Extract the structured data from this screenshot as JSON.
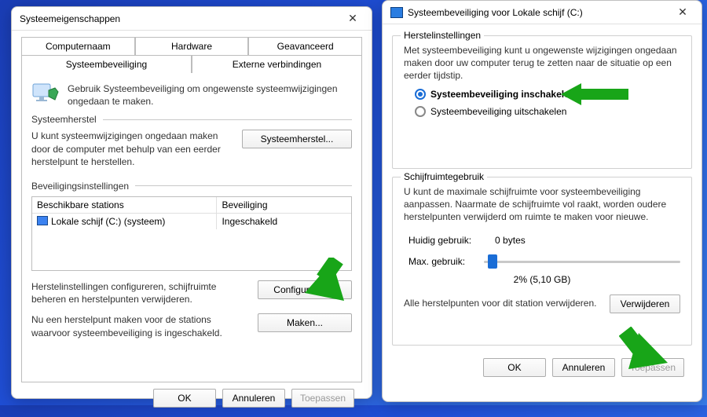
{
  "left": {
    "title": "Systeemeigenschappen",
    "tabs": {
      "computer": "Computernaam",
      "hardware": "Hardware",
      "advanced": "Geavanceerd",
      "protection": "Systeembeveiliging",
      "remote": "Externe verbindingen"
    },
    "intro": "Gebruik Systeembeveiliging om ongewenste systeemwijzigingen ongedaan te maken.",
    "restore": {
      "legend": "Systeemherstel",
      "desc": "U kunt systeemwijzigingen ongedaan maken door de computer met behulp van een eerder herstelpunt te herstellen.",
      "button": "Systeemherstel..."
    },
    "settings": {
      "legend": "Beveiligingsinstellingen",
      "col_drive": "Beschikbare stations",
      "col_protect": "Beveiliging",
      "drive": "Lokale schijf (C:) (systeem)",
      "status": "Ingeschakeld",
      "configure_desc": "Herstelinstellingen configureren, schijfruimte beheren en herstelpunten verwijderen.",
      "configure_btn": "Configureren...",
      "create_desc": "Nu een herstelpunt maken voor de stations waarvoor systeembeveiliging is ingeschakeld.",
      "create_btn": "Maken..."
    },
    "footer": {
      "ok": "OK",
      "cancel": "Annuleren",
      "apply": "Toepassen"
    }
  },
  "right": {
    "title": "Systeembeveiliging voor Lokale schijf (C:)",
    "restore_group": "Herstelinstellingen",
    "restore_intro": "Met systeembeveiliging kunt u ongewenste wijzigingen ongedaan maken door uw computer terug te zetten naar de situatie op een eerder tijdstip.",
    "radio_on": "Systeembeveiliging inschakelen",
    "radio_off": "Systeembeveiliging uitschakelen",
    "usage_group": "Schijfruimtegebruik",
    "usage_intro": "U kunt de maximale schijfruimte voor systeembeveiliging aanpassen. Naarmate de schijfruimte vol raakt, worden oudere herstelpunten verwijderd om ruimte te maken voor nieuwe.",
    "current_label": "Huidig gebruik:",
    "current_value": "0 bytes",
    "max_label": "Max. gebruik:",
    "slider_pct": "2% (5,10 GB)",
    "delete_desc": "Alle herstelpunten voor dit station verwijderen.",
    "delete_btn": "Verwijderen",
    "footer": {
      "ok": "OK",
      "cancel": "Annuleren",
      "apply": "Toepassen"
    }
  }
}
